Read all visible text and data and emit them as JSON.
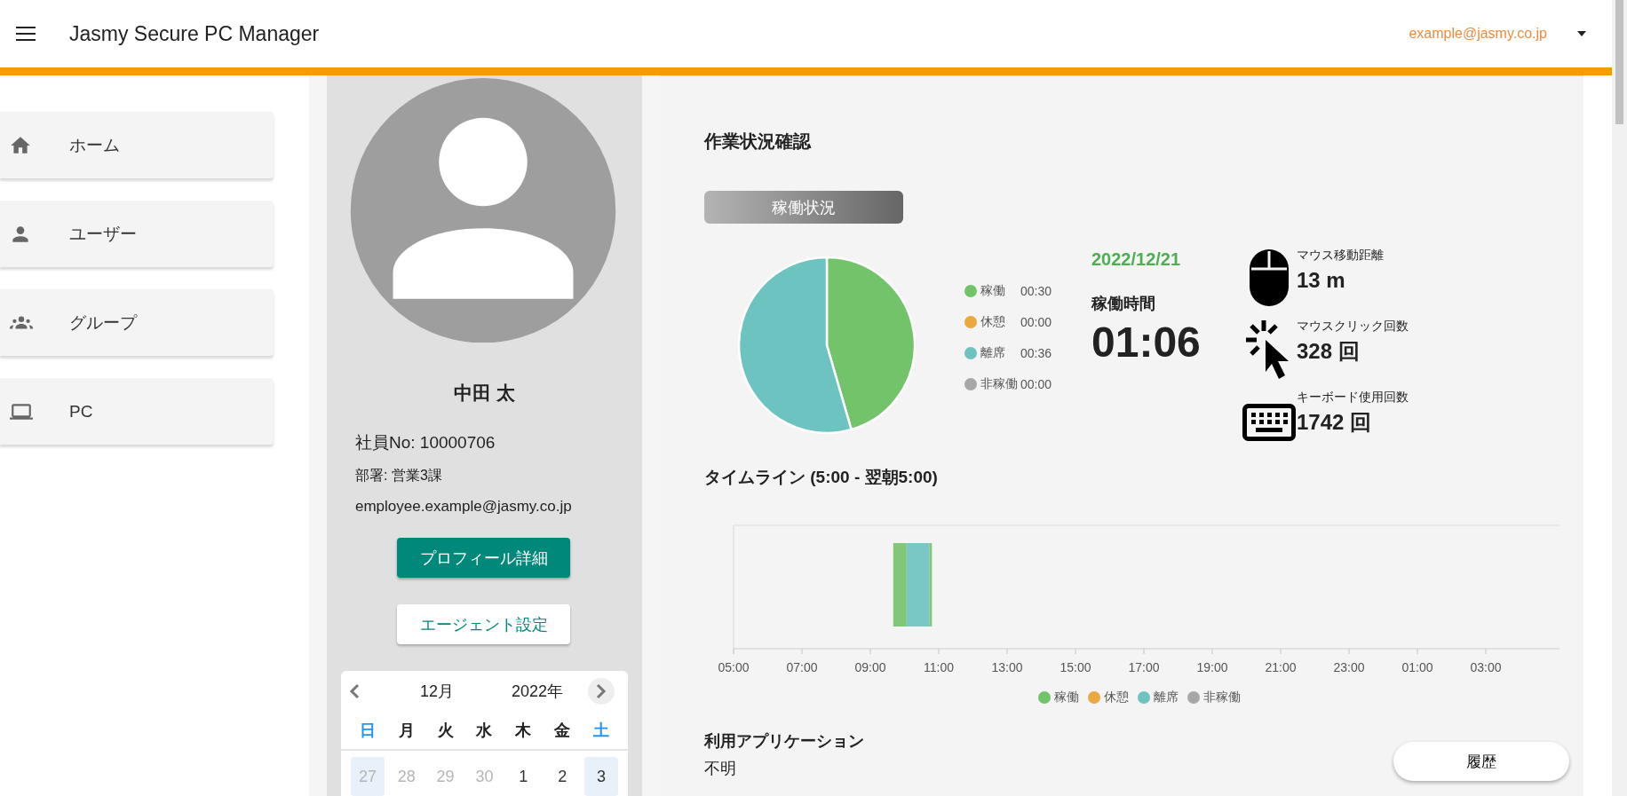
{
  "header": {
    "title": "Jasmy Secure PC Manager",
    "account": "example@jasmy.co.jp"
  },
  "sidebar": {
    "items": [
      {
        "label": "ホーム",
        "kind": "home"
      },
      {
        "label": "ユーザー",
        "kind": "user"
      },
      {
        "label": "グループ",
        "kind": "group"
      },
      {
        "label": "PC",
        "kind": "pc"
      }
    ]
  },
  "profile": {
    "name": "中田 太",
    "employee_no": "社員No: 10000706",
    "department": "部署: 営業3課",
    "email": "employee.example@jasmy.co.jp",
    "buttons": [
      {
        "label": "プロフィール詳細",
        "kind": "primary"
      },
      {
        "label": "エージェント設定",
        "kind": "outlined"
      }
    ],
    "calendar": {
      "month": "12月",
      "year": "2022年",
      "weekdays": [
        {
          "label": "日",
          "color": "#2196f3"
        },
        {
          "label": "月",
          "color": "#222222"
        },
        {
          "label": "火",
          "color": "#222222"
        },
        {
          "label": "水",
          "color": "#222222"
        },
        {
          "label": "木",
          "color": "#222222"
        },
        {
          "label": "金",
          "color": "#222222"
        },
        {
          "label": "土",
          "color": "#2196f3"
        }
      ],
      "days": [
        {
          "label": "27",
          "outside": true
        },
        {
          "label": "28",
          "outside": true
        },
        {
          "label": "29",
          "outside": true
        },
        {
          "label": "30",
          "outside": true
        },
        {
          "label": "1",
          "outside": false
        },
        {
          "label": "2",
          "outside": false
        },
        {
          "label": "3",
          "outside": false
        }
      ]
    }
  },
  "work_status": {
    "title": "作業状況確認",
    "tab": "稼働状況",
    "summary_chart": {
      "chart_data": {
        "type": "pie",
        "categories": [
          "稼働",
          "休憩",
          "離席",
          "非稼働"
        ],
        "values": [
          45.5,
          0,
          54.5,
          0
        ]
      }
    },
    "legend": [
      {
        "time": "00:30",
        "color": "#73c36a"
      },
      {
        "time": "00:00",
        "color": "#eaa93f"
      },
      {
        "time": "00:36",
        "color": "#6cc3c0"
      },
      {
        "time": "00:00",
        "color": "#a8a8a8"
      }
    ],
    "date": "2022/12/21",
    "uptime_label": "稼働時間",
    "uptime": "01:06",
    "stats": [
      {
        "kind": "mouse",
        "label": "マウス移動距離",
        "value": "13 m"
      },
      {
        "kind": "click",
        "label": "マウスクリック回数",
        "value": "328 回"
      },
      {
        "kind": "keyboard",
        "label": "キーボード使用回数",
        "value": "1742 回"
      }
    ],
    "timeline": {
      "title": "タイムライン (5:00 - 翌朝5:00)",
      "axis_labels": [
        "05:00",
        "07:00",
        "09:00",
        "11:00",
        "13:00",
        "15:00",
        "17:00",
        "19:00",
        "21:00",
        "23:00",
        "01:00",
        "03:00"
      ],
      "legend": [
        {
          "name": "稼働",
          "color": "#73c36a"
        },
        {
          "name": "休憩",
          "color": "#eaa93f"
        },
        {
          "name": "離席",
          "color": "#6cc3c0"
        },
        {
          "name": "非稼働",
          "color": "#a8a8a8"
        }
      ]
    },
    "applications": {
      "title": "利用アプリケーション",
      "value": "不明"
    },
    "history_button": "履歴"
  }
}
